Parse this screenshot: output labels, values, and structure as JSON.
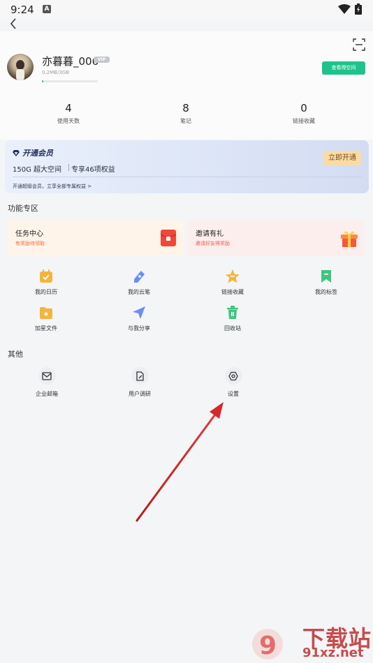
{
  "status_bar": {
    "time": "9:24",
    "notification_letter": "A"
  },
  "profile": {
    "username": "亦暮暮_006",
    "vip_badge": "VIP",
    "storage": "0.2MB/3GB",
    "storage_used_fraction": 0.02,
    "space_button": "查看得空间"
  },
  "stats": [
    {
      "value": "4",
      "label": "使用天数"
    },
    {
      "value": "8",
      "label": "笔记"
    },
    {
      "value": "0",
      "label": "链接收藏"
    }
  ],
  "vip_card": {
    "title": "开通会员",
    "benefit1": "150G 超大空间",
    "benefit2": "专享46项权益",
    "open_button": "立即开通",
    "subtitle": "开通超级会员，立享全部专属权益 >"
  },
  "features": {
    "title": "功能专区",
    "promos": [
      {
        "title": "任务中心",
        "subtitle": "有奖励待领取",
        "icon": "red-packet-icon"
      },
      {
        "title": "邀请有礼",
        "subtitle": "邀请好友得奖励",
        "icon": "gift-icon"
      }
    ],
    "grid": [
      {
        "label": "我的日历",
        "icon": "calendar-icon",
        "color": "#f5b43a"
      },
      {
        "label": "我的云笔",
        "icon": "pen-icon",
        "color": "#6b8ef5"
      },
      {
        "label": "链接收藏",
        "icon": "star-icon",
        "color": "#f5b43a"
      },
      {
        "label": "我的标签",
        "icon": "bookmark-icon",
        "color": "#3dc67e"
      },
      {
        "label": "加星文件",
        "icon": "folder-star-icon",
        "color": "#f5b43a"
      },
      {
        "label": "与我分享",
        "icon": "share-icon",
        "color": "#6b8ef5"
      },
      {
        "label": "回收站",
        "icon": "trash-icon",
        "color": "#3dc67e"
      }
    ]
  },
  "other": {
    "title": "其他",
    "items": [
      {
        "label": "企业邮箱",
        "icon": "mail-icon"
      },
      {
        "label": "用户调研",
        "icon": "survey-icon"
      },
      {
        "label": "设置",
        "icon": "settings-icon"
      }
    ]
  },
  "watermark": {
    "main": "下载站",
    "site": "91xz.net",
    "logo": "9"
  },
  "colors": {
    "accent_green": "#1ec38a",
    "annotation_arrow": "#d42a2a"
  }
}
